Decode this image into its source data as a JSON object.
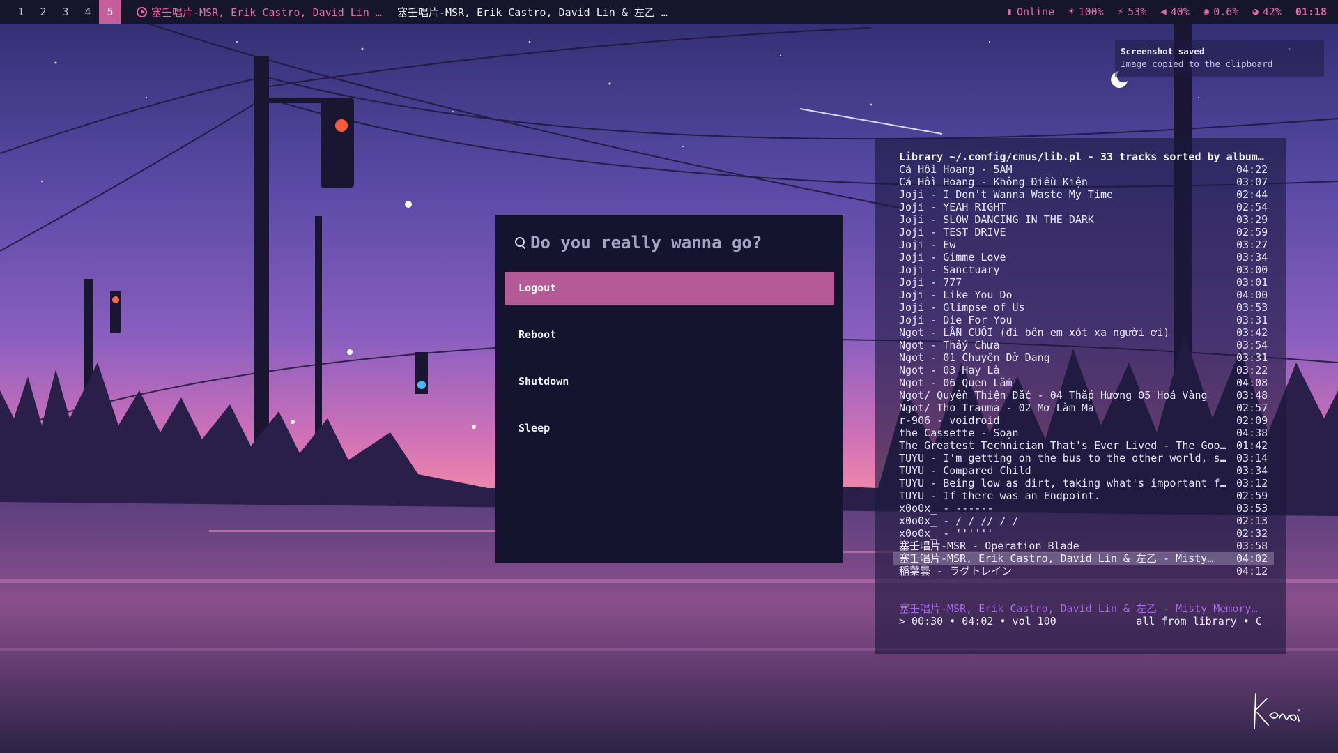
{
  "workspaces": [
    {
      "label": "1",
      "active": false
    },
    {
      "label": "2",
      "active": false
    },
    {
      "label": "3",
      "active": false
    },
    {
      "label": "4",
      "active": false
    },
    {
      "label": "5",
      "active": true
    }
  ],
  "topbar": {
    "now_playing": "塞壬唱片-MSR, Erik Castro, David Lin …",
    "window_title": "塞壬唱片-MSR, Erik Castro, David Lin & 左乙 …",
    "status": {
      "network": "Online",
      "brightness": "100%",
      "battery": "53%",
      "volume": "40%",
      "cpu": "0.6%",
      "memory": "42%",
      "clock": "01:18"
    }
  },
  "notification": {
    "title": "Screenshot saved",
    "body": "Image copied to the clipboard"
  },
  "power_menu": {
    "prompt": "Do you really wanna go?",
    "options": [
      "Logout",
      "Reboot",
      "Shutdown",
      "Sleep"
    ],
    "selected_index": 0
  },
  "cmus": {
    "header": "Library ~/.config/cmus/lib.pl - 33 tracks sorted by album…",
    "tracks": [
      {
        "title": "Cá Hồi Hoang - 5AM",
        "duration": "04:22"
      },
      {
        "title": "Cá Hồi Hoang - Không Điều Kiện",
        "duration": "03:07"
      },
      {
        "title": "Joji - I Don't Wanna Waste My Time",
        "duration": "02:44"
      },
      {
        "title": "Joji - YEAH RIGHT",
        "duration": "02:54"
      },
      {
        "title": "Joji - SLOW DANCING IN THE DARK",
        "duration": "03:29"
      },
      {
        "title": "Joji - TEST DRIVE",
        "duration": "02:59"
      },
      {
        "title": "Joji - Ew",
        "duration": "03:27"
      },
      {
        "title": "Joji - Gimme Love",
        "duration": "03:34"
      },
      {
        "title": "Joji - Sanctuary",
        "duration": "03:00"
      },
      {
        "title": "Joji - 777",
        "duration": "03:01"
      },
      {
        "title": "Joji - Like You Do",
        "duration": "04:00"
      },
      {
        "title": "Joji - Glimpse of Us",
        "duration": "03:53"
      },
      {
        "title": "Joji - Die For You",
        "duration": "03:31"
      },
      {
        "title": "Ngot - LẦN CUỐI (đi bên em xót xa người ơi)",
        "duration": "03:42"
      },
      {
        "title": "Ngot - Thấy Chưa",
        "duration": "03:54"
      },
      {
        "title": "Ngot - 01 Chuyện Dở Dang",
        "duration": "03:31"
      },
      {
        "title": "Ngot - 03 Hay Là",
        "duration": "03:22"
      },
      {
        "title": "Ngot - 06 Quen Lắm",
        "duration": "04:08"
      },
      {
        "title": "Ngot/ Quyền Thiện Đắc - 04 Thắp Hương 05 Hoá Vàng",
        "duration": "03:48"
      },
      {
        "title": "Ngot/ Tho Trauma - 02 Mơ Làm Ma",
        "duration": "02:57"
      },
      {
        "title": "r-906 - voidroid",
        "duration": "02:09"
      },
      {
        "title": "the Cassette - Soạn",
        "duration": "04:38"
      },
      {
        "title": "The Greatest Technician That's Ever Lived - The Goo…",
        "duration": "01:42"
      },
      {
        "title": "TUYU - I'm getting on the bus to the other world, s…",
        "duration": "03:14"
      },
      {
        "title": "TUYU - Compared Child",
        "duration": "03:34"
      },
      {
        "title": "TUYU - Being low as dirt, taking what's important f…",
        "duration": "03:12"
      },
      {
        "title": "TUYU - If there was an Endpoint.",
        "duration": "02:59"
      },
      {
        "title": "x0o0x_ - ------",
        "duration": "03:53"
      },
      {
        "title": "x0o0x_ - / / // / /",
        "duration": "02:13"
      },
      {
        "title": "x0o0x_ - ''''''",
        "duration": "02:32"
      },
      {
        "title": "塞壬唱片-MSR - Operation Blade",
        "duration": "03:58"
      },
      {
        "title": "塞壬唱片-MSR, Erik Castro, David Lin & 左乙 - Misty…",
        "duration": "04:02",
        "current": true
      },
      {
        "title": "稲葉曇 - ラグトレイン",
        "duration": "04:12"
      }
    ],
    "now_playing": "塞壬唱片-MSR, Erik Castro, David Lin & 左乙 - Misty Memory…",
    "position_line": "> 00:30 • 04:02 • vol 100",
    "mode_line": "all from library • C "
  },
  "signature": "Kenami",
  "colors": {
    "accent_pink": "#e46aa6",
    "menu_selected": "#b45b97",
    "active_workspace": "#c65e9e",
    "cmus_now_playing": "#a46ae8"
  }
}
